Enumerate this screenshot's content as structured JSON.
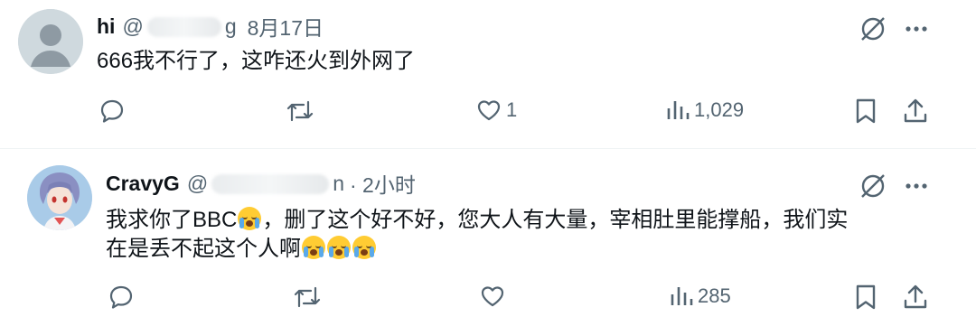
{
  "tweets": [
    {
      "name": "hi",
      "handle_prefix": "@",
      "handle_suffix": "g",
      "date": "8月17日",
      "text": "666我不行了，这咋还火到外网了",
      "actions": {
        "reply": "",
        "retweet": "",
        "like": "1",
        "views": "1,029"
      },
      "icons": [
        "slash-circle-icon",
        "more-icon",
        "reply-icon",
        "retweet-icon",
        "heart-icon",
        "views-icon",
        "bookmark-icon",
        "share-icon"
      ]
    },
    {
      "name": "CravyG",
      "handle_prefix": "@",
      "handle_suffix": "n",
      "date": "· 2小时",
      "text_line1_a": "我求你了BBC",
      "text_line1_b": "，删了这个好不好，您大人有大量，宰相肚里能撑船，我们实",
      "text_line2_a": "在是丢不起这个人啊",
      "emoji": "loudly-crying-face",
      "actions": {
        "reply": "",
        "retweet": "",
        "like": "",
        "views": "285"
      }
    }
  ],
  "colors": {
    "text": "#0f1419",
    "muted": "#536471",
    "divider": "#eff3f4"
  }
}
